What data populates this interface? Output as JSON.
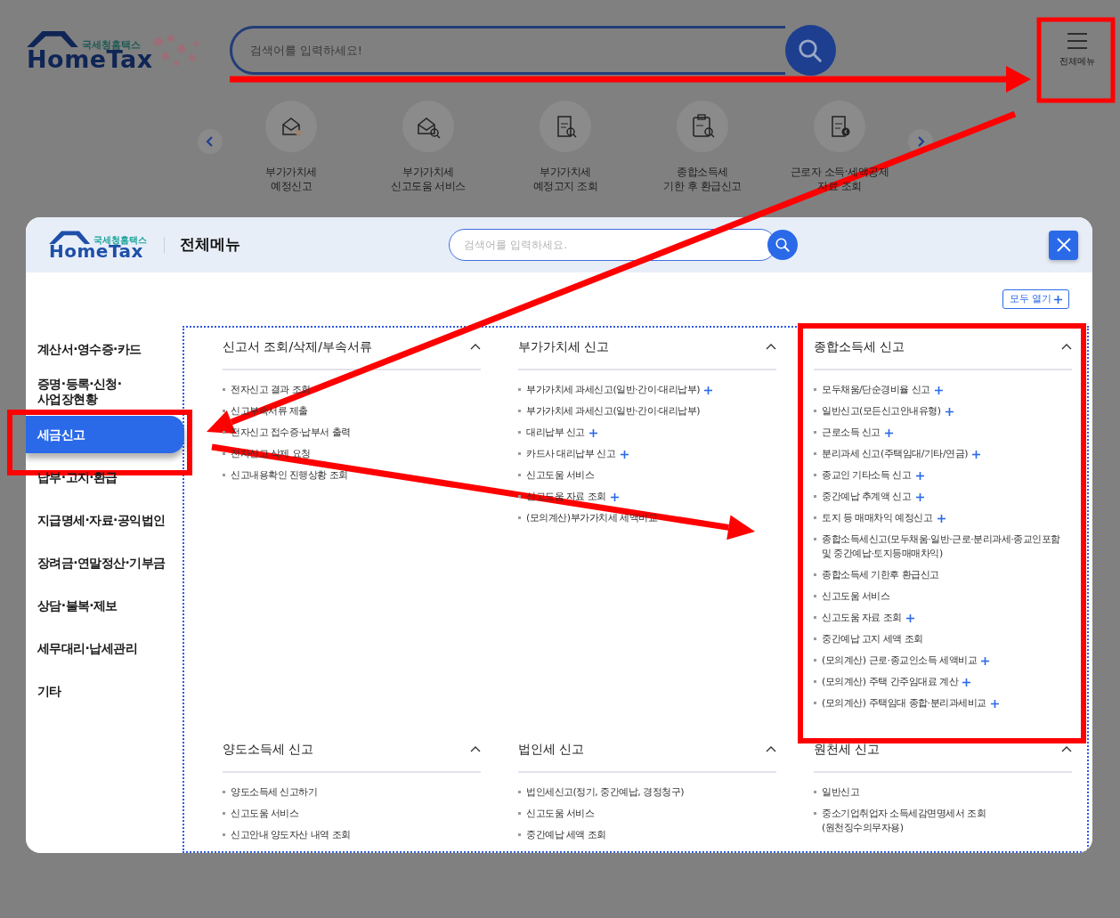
{
  "background_page": {
    "logo": {
      "small": "국세청홈택스",
      "big": "HomeTax"
    },
    "search": {
      "placeholder": "검색어를 입력하세요!"
    },
    "menu_button": "전체메뉴",
    "quick_menu": [
      {
        "kind": "envelope",
        "label": "부가가치세\n예정신고"
      },
      {
        "kind": "envelope-search",
        "label": "부가가치세\n신고도움 서비스"
      },
      {
        "kind": "receipt-search",
        "label": "부가가치세\n예정고지 조회"
      },
      {
        "kind": "clipboard-search",
        "label": "종합소득세\n기한 후 환급신고"
      },
      {
        "kind": "receipt-arrow",
        "label": "근로자 소득·세액공제\n자료 조회"
      }
    ]
  },
  "modal": {
    "logo": {
      "small": "국세청홈택스",
      "big": "HomeTax"
    },
    "title": "전체메뉴",
    "search": {
      "placeholder": "검색어를 입력하세요."
    },
    "expand_all": "모두 열기",
    "sidebar": [
      {
        "label": "계산서·영수증·카드",
        "selected": false
      },
      {
        "label": "증명·등록·신청·\n사업장현황",
        "selected": false
      },
      {
        "label": "세금신고",
        "selected": true
      },
      {
        "label": "납부·고지·환급",
        "selected": false
      },
      {
        "label": "지급명세·자료·공익법인",
        "selected": false
      },
      {
        "label": "장려금·연말정산·기부금",
        "selected": false
      },
      {
        "label": "상담·불복·제보",
        "selected": false
      },
      {
        "label": "세무대리·납세관리",
        "selected": false
      },
      {
        "label": "기타",
        "selected": false
      }
    ],
    "sections": [
      {
        "title": "신고서 조회/삭제/부속서류",
        "expanded": true,
        "items": [
          {
            "label": "전자신고 결과 조회",
            "plus": false
          },
          {
            "label": "신고부속서류 제출",
            "plus": false
          },
          {
            "label": "전자신고 접수증·납부서 출력",
            "plus": false
          },
          {
            "label": "전자신고 삭제 요청",
            "plus": false
          },
          {
            "label": "신고내용확인 진행상황 조회",
            "plus": false
          }
        ]
      },
      {
        "title": "부가가치세 신고",
        "expanded": true,
        "items": [
          {
            "label": "부가가치세 과세신고(일반·간이·대리납부)",
            "plus": true
          },
          {
            "label": "부가가치세 과세신고(일반·간이·대리납부)",
            "plus": false
          },
          {
            "label": "대리납부 신고",
            "plus": true
          },
          {
            "label": "카드사 대리납부 신고",
            "plus": true
          },
          {
            "label": "신고도움 서비스",
            "plus": false
          },
          {
            "label": "신고도움 자료 조회",
            "plus": true
          },
          {
            "label": "(모의계산)부가가치세 세액비교",
            "plus": false
          }
        ]
      },
      {
        "title": "종합소득세 신고",
        "expanded": true,
        "items": [
          {
            "label": "모두채움/단순경비율 신고",
            "plus": true
          },
          {
            "label": "일반신고(모든신고안내유형)",
            "plus": true
          },
          {
            "label": "근로소득 신고",
            "plus": true
          },
          {
            "label": "분리과세 신고(주택임대/기타/연금)",
            "plus": true
          },
          {
            "label": "종교인 기타소득 신고",
            "plus": true
          },
          {
            "label": "중간예납 추계액 신고",
            "plus": true
          },
          {
            "label": "토지 등 매매차익 예정신고",
            "plus": true
          },
          {
            "label": "종합소득세신고(모두채움·일반·근로·분리과세·종교인포함\n및 중간예납·토지등매매차익)",
            "plus": false
          },
          {
            "label": "종합소득세 기한후 환급신고",
            "plus": false
          },
          {
            "label": "신고도움 서비스",
            "plus": false
          },
          {
            "label": "신고도움 자료 조회",
            "plus": true
          },
          {
            "label": "중간예납 고지 세액 조회",
            "plus": false
          },
          {
            "label": "(모의계산) 근로·종교인소득 세액비교",
            "plus": true
          },
          {
            "label": "(모의계산) 주택 간주임대료 계산",
            "plus": true
          },
          {
            "label": "(모의계산) 주택임대 종합·분리과세비교",
            "plus": true
          }
        ]
      },
      {
        "title": "양도소득세 신고",
        "expanded": true,
        "items": [
          {
            "label": "양도소득세 신고하기",
            "plus": false
          },
          {
            "label": "신고도움 서비스",
            "plus": false
          },
          {
            "label": "신고안내 양도자산 내역 조회",
            "plus": false
          }
        ]
      },
      {
        "title": "법인세 신고",
        "expanded": true,
        "items": [
          {
            "label": "법인세신고(정기, 중간예납, 경정청구)",
            "plus": false
          },
          {
            "label": "신고도움 서비스",
            "plus": false
          },
          {
            "label": "중간예납 세액 조회",
            "plus": false
          }
        ]
      },
      {
        "title": "원천세 신고",
        "expanded": true,
        "items": [
          {
            "label": "일반신고",
            "plus": false
          },
          {
            "label": "중소기업취업자 소득세감면명세서 조회\n(원천징수의무자용)",
            "plus": false
          }
        ]
      }
    ]
  }
}
